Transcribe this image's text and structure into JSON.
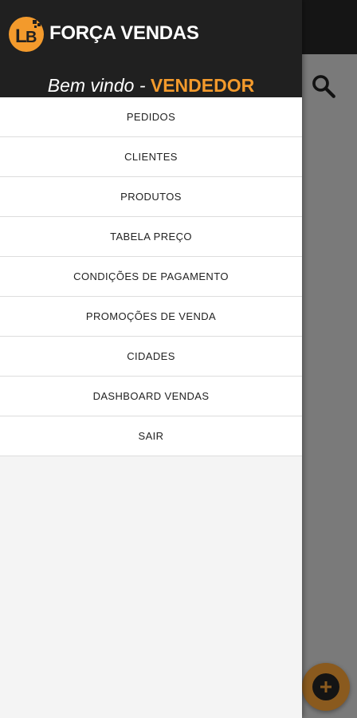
{
  "header": {
    "logo_text": "LB",
    "title": "FORÇA VENDAS",
    "welcome": "Bem vindo",
    "separator": "-",
    "role": "VENDEDOR"
  },
  "menu": {
    "items": [
      {
        "label": "PEDIDOS"
      },
      {
        "label": "CLIENTES"
      },
      {
        "label": "PRODUTOS"
      },
      {
        "label": "TABELA PREÇO"
      },
      {
        "label": "CONDIÇÕES DE PAGAMENTO"
      },
      {
        "label": "PROMOÇÕES DE VENDA"
      },
      {
        "label": "CIDADES"
      },
      {
        "label": "DASHBOARD VENDAS"
      },
      {
        "label": "SAIR"
      }
    ]
  },
  "background": {
    "search_icon": "search-icon",
    "fab_icon": "plus-icon"
  },
  "colors": {
    "accent": "#f39a2c",
    "header_bg": "#202020",
    "drawer_bg": "#f4f4f4",
    "fab": "#8a5a1e"
  }
}
